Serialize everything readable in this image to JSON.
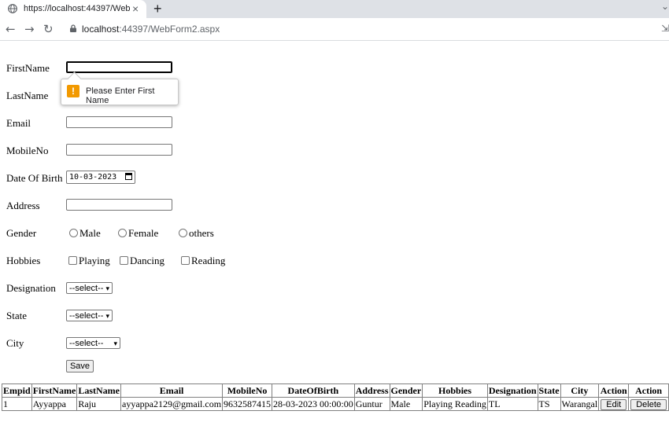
{
  "browser": {
    "tab_title": "https://localhost:44397/WebForm",
    "close_glyph": "×",
    "newtab_glyph": "+",
    "menu_glyph": "⌄",
    "back_glyph": "←",
    "forward_glyph": "→",
    "reload_glyph": "↻",
    "url_host": "localhost",
    "url_path": ":44397/WebForm2.aspx",
    "share_glyph": "⇲"
  },
  "form": {
    "labels": {
      "firstname": "FirstName",
      "lastname": "LastName",
      "email": "Email",
      "mobile": "MobileNo",
      "dob": "Date Of Birth",
      "address": "Address",
      "gender": "Gender",
      "hobbies": "Hobbies",
      "designation": "Designation",
      "state": "State",
      "city": "City"
    },
    "dob_value": "10-03-2023",
    "gender_options": [
      "Male",
      "Female",
      "others"
    ],
    "hobby_options": [
      "Playing",
      "Dancing",
      "Reading"
    ],
    "designation_selected": "--select--",
    "state_selected": "--select--",
    "city_selected": "--select--",
    "select_arrow": "▾",
    "save_label": "Save",
    "validation_message": "Please Enter First Name",
    "warning_glyph": "!"
  },
  "table": {
    "headers": [
      "Empid",
      "FirstName",
      "LastName",
      "Email",
      "MobileNo",
      "DateOfBirth",
      "Address",
      "Gender",
      "Hobbies",
      "Designation",
      "State",
      "City",
      "Action",
      "Action"
    ],
    "rows": [
      {
        "empid": "1",
        "firstname": "Ayyappa",
        "lastname": "Raju",
        "email": "ayyappa2129@gmail.com",
        "mobile": "9632587415",
        "dob": "28-03-2023 00:00:00",
        "address": "Guntur",
        "gender": "Male",
        "hobbies": "Playing Reading",
        "designation": "TL",
        "state": "TS",
        "city": "Warangal",
        "edit_label": "Edit",
        "delete_label": "Delete"
      }
    ]
  },
  "colors": {
    "warning": "#f29900",
    "tabbar": "#dee1e6"
  }
}
